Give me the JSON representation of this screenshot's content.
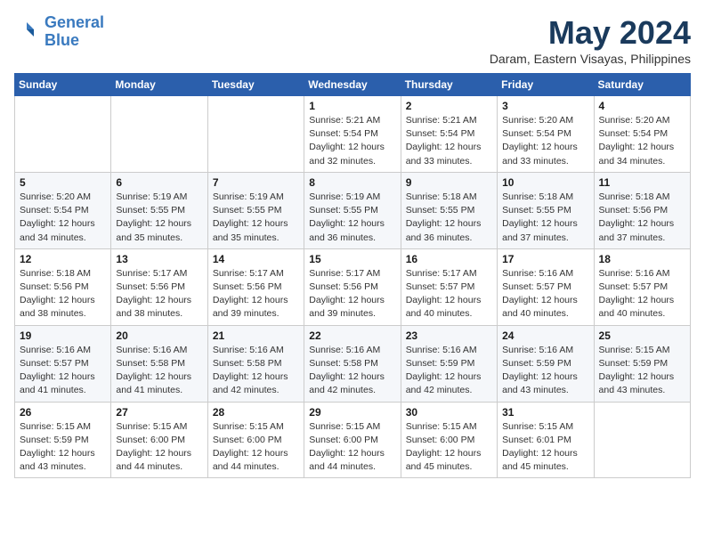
{
  "header": {
    "logo_line1": "General",
    "logo_line2": "Blue",
    "month_year": "May 2024",
    "location": "Daram, Eastern Visayas, Philippines"
  },
  "days_of_week": [
    "Sunday",
    "Monday",
    "Tuesday",
    "Wednesday",
    "Thursday",
    "Friday",
    "Saturday"
  ],
  "weeks": [
    [
      {
        "day": "",
        "info": ""
      },
      {
        "day": "",
        "info": ""
      },
      {
        "day": "",
        "info": ""
      },
      {
        "day": "1",
        "info": "Sunrise: 5:21 AM\nSunset: 5:54 PM\nDaylight: 12 hours\nand 32 minutes."
      },
      {
        "day": "2",
        "info": "Sunrise: 5:21 AM\nSunset: 5:54 PM\nDaylight: 12 hours\nand 33 minutes."
      },
      {
        "day": "3",
        "info": "Sunrise: 5:20 AM\nSunset: 5:54 PM\nDaylight: 12 hours\nand 33 minutes."
      },
      {
        "day": "4",
        "info": "Sunrise: 5:20 AM\nSunset: 5:54 PM\nDaylight: 12 hours\nand 34 minutes."
      }
    ],
    [
      {
        "day": "5",
        "info": "Sunrise: 5:20 AM\nSunset: 5:54 PM\nDaylight: 12 hours\nand 34 minutes."
      },
      {
        "day": "6",
        "info": "Sunrise: 5:19 AM\nSunset: 5:55 PM\nDaylight: 12 hours\nand 35 minutes."
      },
      {
        "day": "7",
        "info": "Sunrise: 5:19 AM\nSunset: 5:55 PM\nDaylight: 12 hours\nand 35 minutes."
      },
      {
        "day": "8",
        "info": "Sunrise: 5:19 AM\nSunset: 5:55 PM\nDaylight: 12 hours\nand 36 minutes."
      },
      {
        "day": "9",
        "info": "Sunrise: 5:18 AM\nSunset: 5:55 PM\nDaylight: 12 hours\nand 36 minutes."
      },
      {
        "day": "10",
        "info": "Sunrise: 5:18 AM\nSunset: 5:55 PM\nDaylight: 12 hours\nand 37 minutes."
      },
      {
        "day": "11",
        "info": "Sunrise: 5:18 AM\nSunset: 5:56 PM\nDaylight: 12 hours\nand 37 minutes."
      }
    ],
    [
      {
        "day": "12",
        "info": "Sunrise: 5:18 AM\nSunset: 5:56 PM\nDaylight: 12 hours\nand 38 minutes."
      },
      {
        "day": "13",
        "info": "Sunrise: 5:17 AM\nSunset: 5:56 PM\nDaylight: 12 hours\nand 38 minutes."
      },
      {
        "day": "14",
        "info": "Sunrise: 5:17 AM\nSunset: 5:56 PM\nDaylight: 12 hours\nand 39 minutes."
      },
      {
        "day": "15",
        "info": "Sunrise: 5:17 AM\nSunset: 5:56 PM\nDaylight: 12 hours\nand 39 minutes."
      },
      {
        "day": "16",
        "info": "Sunrise: 5:17 AM\nSunset: 5:57 PM\nDaylight: 12 hours\nand 40 minutes."
      },
      {
        "day": "17",
        "info": "Sunrise: 5:16 AM\nSunset: 5:57 PM\nDaylight: 12 hours\nand 40 minutes."
      },
      {
        "day": "18",
        "info": "Sunrise: 5:16 AM\nSunset: 5:57 PM\nDaylight: 12 hours\nand 40 minutes."
      }
    ],
    [
      {
        "day": "19",
        "info": "Sunrise: 5:16 AM\nSunset: 5:57 PM\nDaylight: 12 hours\nand 41 minutes."
      },
      {
        "day": "20",
        "info": "Sunrise: 5:16 AM\nSunset: 5:58 PM\nDaylight: 12 hours\nand 41 minutes."
      },
      {
        "day": "21",
        "info": "Sunrise: 5:16 AM\nSunset: 5:58 PM\nDaylight: 12 hours\nand 42 minutes."
      },
      {
        "day": "22",
        "info": "Sunrise: 5:16 AM\nSunset: 5:58 PM\nDaylight: 12 hours\nand 42 minutes."
      },
      {
        "day": "23",
        "info": "Sunrise: 5:16 AM\nSunset: 5:59 PM\nDaylight: 12 hours\nand 42 minutes."
      },
      {
        "day": "24",
        "info": "Sunrise: 5:16 AM\nSunset: 5:59 PM\nDaylight: 12 hours\nand 43 minutes."
      },
      {
        "day": "25",
        "info": "Sunrise: 5:15 AM\nSunset: 5:59 PM\nDaylight: 12 hours\nand 43 minutes."
      }
    ],
    [
      {
        "day": "26",
        "info": "Sunrise: 5:15 AM\nSunset: 5:59 PM\nDaylight: 12 hours\nand 43 minutes."
      },
      {
        "day": "27",
        "info": "Sunrise: 5:15 AM\nSunset: 6:00 PM\nDaylight: 12 hours\nand 44 minutes."
      },
      {
        "day": "28",
        "info": "Sunrise: 5:15 AM\nSunset: 6:00 PM\nDaylight: 12 hours\nand 44 minutes."
      },
      {
        "day": "29",
        "info": "Sunrise: 5:15 AM\nSunset: 6:00 PM\nDaylight: 12 hours\nand 44 minutes."
      },
      {
        "day": "30",
        "info": "Sunrise: 5:15 AM\nSunset: 6:00 PM\nDaylight: 12 hours\nand 45 minutes."
      },
      {
        "day": "31",
        "info": "Sunrise: 5:15 AM\nSunset: 6:01 PM\nDaylight: 12 hours\nand 45 minutes."
      },
      {
        "day": "",
        "info": ""
      }
    ]
  ]
}
